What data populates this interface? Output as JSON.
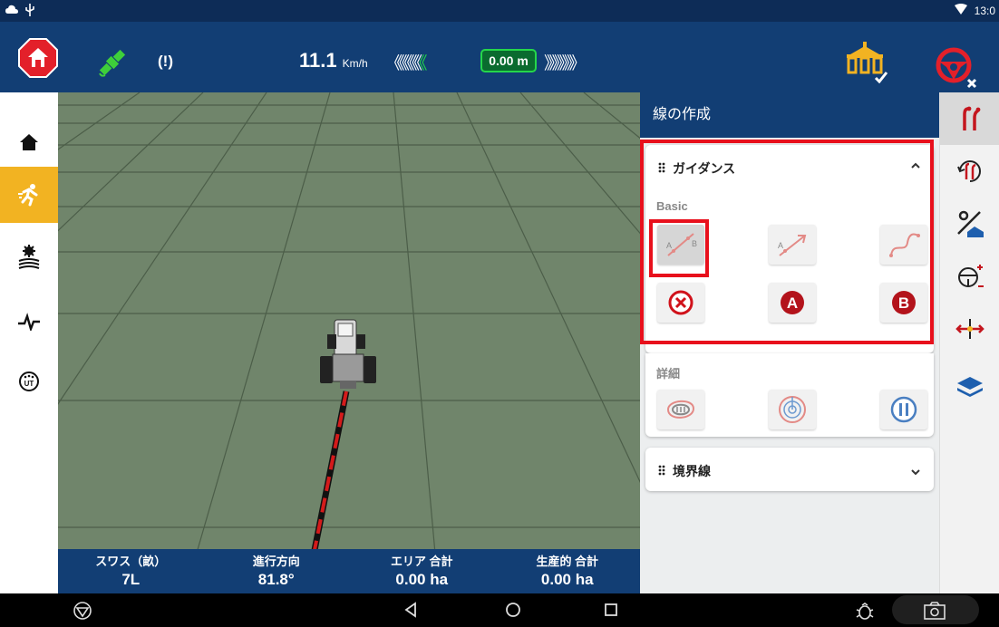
{
  "status_bar": {
    "time": "13:0"
  },
  "top_bar": {
    "speed_value": "11.1",
    "speed_unit": "Km/h",
    "chevrons_left": "《《《《《",
    "chevrons_left_active": "《",
    "cross_track_offset": "0.00 m",
    "chevrons_right": "》》》》》》",
    "radio_label": "(!)",
    "colors": {
      "bar": "#123e74",
      "offset_green": "#25d64a",
      "alert_red": "#e3202a"
    }
  },
  "left_nav": {
    "items": [
      {
        "icon": "home-icon",
        "active": false
      },
      {
        "icon": "runner-icon",
        "active": true
      },
      {
        "icon": "field-gear-icon",
        "active": false
      },
      {
        "icon": "pulse-icon",
        "active": false
      },
      {
        "icon": "ut-icon",
        "active": false
      }
    ]
  },
  "stats": [
    {
      "label": "スワス（畝）",
      "value": "7L"
    },
    {
      "label": "進行方向",
      "value": "81.8°"
    },
    {
      "label": "エリア 合計",
      "value": "0.00 ha"
    },
    {
      "label": "生産的 合計",
      "value": "0.00 ha"
    }
  ],
  "panel": {
    "title": "線の作成",
    "guidance_card": {
      "title": "ガイダンス",
      "basic_label": "Basic",
      "detail_label": "詳細",
      "ab_labels": {
        "a": "A",
        "b": "B"
      },
      "set_a": "A",
      "set_b": "B"
    },
    "boundary_card": {
      "title": "境界線"
    }
  },
  "nav_bar": {
    "icons": [
      "logo-icon",
      "back-icon",
      "home-circle-icon",
      "recents-icon",
      "bug-icon",
      "camera-icon"
    ]
  }
}
